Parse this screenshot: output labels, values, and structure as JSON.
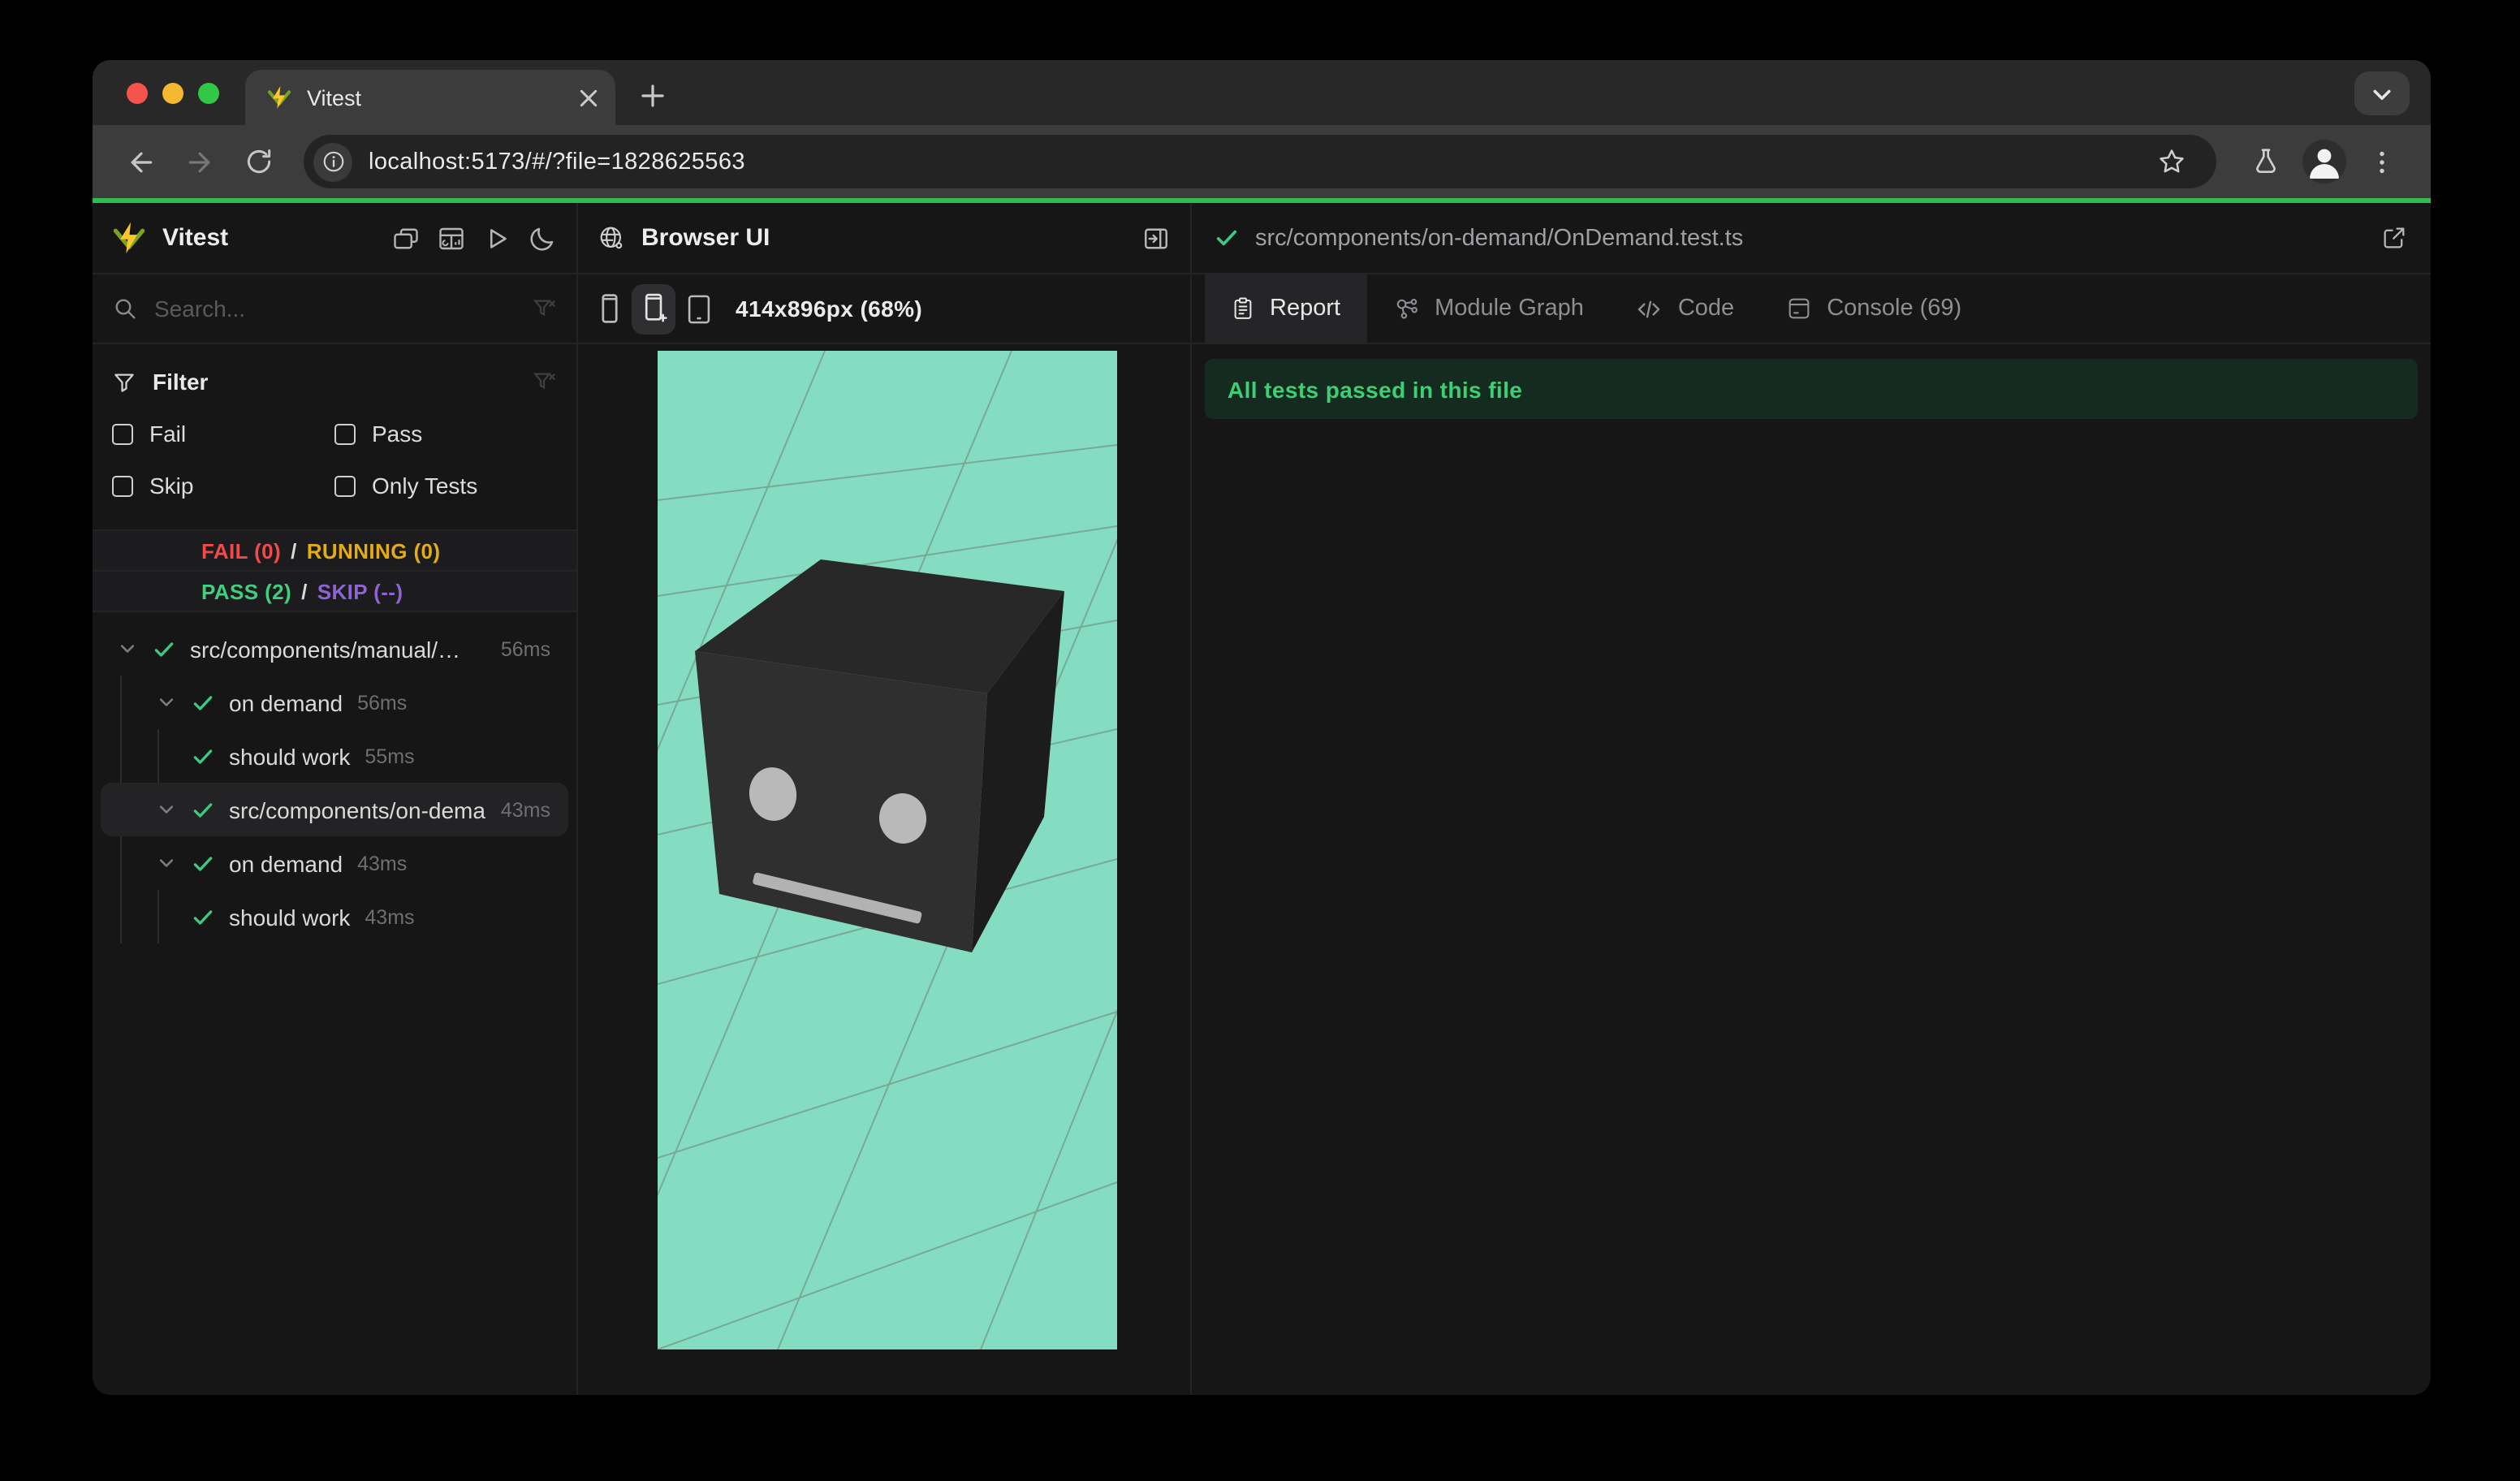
{
  "browser_chrome": {
    "tab_title": "Vitest",
    "url": "localhost:5173/#/?file=1828625563"
  },
  "sidebar": {
    "app_name": "Vitest",
    "search_placeholder": "Search...",
    "filter_title": "Filter",
    "filter_options": {
      "fail": "Fail",
      "pass": "Pass",
      "skip": "Skip",
      "only_tests": "Only Tests"
    },
    "status": {
      "fail": "FAIL (0)",
      "running": "RUNNING (0)",
      "pass": "PASS (2)",
      "skip": "SKIP (--)",
      "separator": "/"
    },
    "tree": [
      {
        "label": "src/components/manual/…",
        "duration": "56ms"
      },
      {
        "label": "on demand",
        "duration": "56ms"
      },
      {
        "label": "should work",
        "duration": "55ms"
      },
      {
        "label": "src/components/on-dema…",
        "duration": "43ms"
      },
      {
        "label": "on demand",
        "duration": "43ms"
      },
      {
        "label": "should work",
        "duration": "43ms"
      }
    ]
  },
  "browser_panel": {
    "title": "Browser UI",
    "viewport_label": "414x896px (68%)"
  },
  "report_panel": {
    "file_path": "src/components/on-demand/OnDemand.test.ts",
    "tabs": {
      "report": "Report",
      "module_graph": "Module Graph",
      "code": "Code",
      "console": "Console (69)"
    },
    "banner": "All tests passed in this file"
  },
  "colors": {
    "progress_green": "#2ebd4e",
    "pass_green": "#3fcf7d",
    "fail_red": "#f24a4a",
    "running_yellow": "#e3ac10",
    "skip_purple": "#8e63d4",
    "viewport_teal": "#84ddc1",
    "banner_bg": "#152b1f",
    "banner_text": "#3dcf74",
    "logo_yellow": "#fcc72b",
    "logo_green": "#7ca31f"
  }
}
